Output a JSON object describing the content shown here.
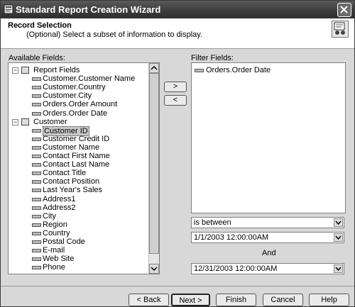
{
  "window": {
    "title": "Standard Report Creation Wizard"
  },
  "header": {
    "title": "Record Selection",
    "subtitle": "(Optional)  Select a subset of information to display."
  },
  "available": {
    "label": "Available Fields:",
    "groups": [
      {
        "name": "Report Fields",
        "icon": "report-fields-icon",
        "items": [
          "Customer.Customer Name",
          "Customer.Country",
          "Customer.City",
          "Orders.Order Amount",
          "Orders.Order Date"
        ]
      },
      {
        "name": "Customer",
        "icon": "table-icon",
        "items": [
          "Customer ID",
          "Customer Credit ID",
          "Customer Name",
          "Contact First Name",
          "Contact Last Name",
          "Contact Title",
          "Contact Position",
          "Last Year's Sales",
          "Address1",
          "Address2",
          "City",
          "Region",
          "Country",
          "Postal Code",
          "E-mail",
          "Web Site",
          "Phone"
        ]
      }
    ],
    "selected_item": "Customer ID"
  },
  "move": {
    "add_label": ">",
    "remove_label": "<"
  },
  "filter": {
    "label": "Filter Fields:",
    "items": [
      "Orders.Order Date"
    ],
    "operator": "is between",
    "value1": "1/1/2003 12:00:00AM",
    "and_label": "And",
    "value2": "12/31/2003 12:00:00AM"
  },
  "buttons": {
    "back": "< Back",
    "next": "Next >",
    "finish": "Finish",
    "cancel": "Cancel",
    "help": "Help"
  }
}
